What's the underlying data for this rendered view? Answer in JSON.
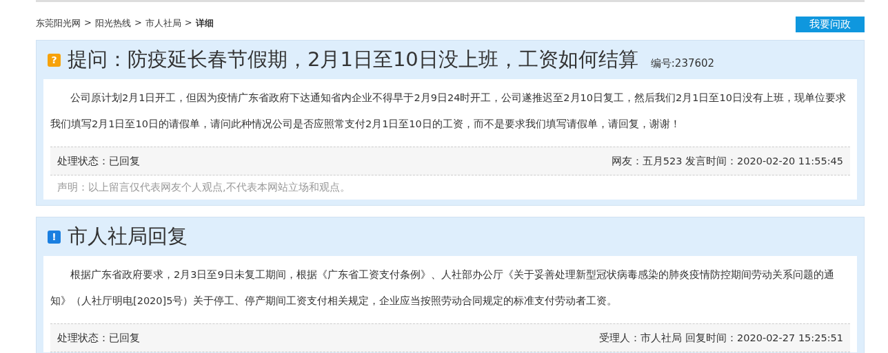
{
  "breadcrumb": {
    "separator": ">",
    "items": [
      {
        "label": "东莞阳光网",
        "current": false
      },
      {
        "label": "阳光热线",
        "current": false
      },
      {
        "label": "市人社局",
        "current": false
      },
      {
        "label": "详细",
        "current": true
      }
    ]
  },
  "ask_button": "我要问政",
  "sections": [
    {
      "kind": "question",
      "icon": "?",
      "title": "提问：防疫延长春节假期，2月1日至10日没上班，工资如何结算",
      "number": "编号:237602",
      "body": "公司原计划2月1日开工，但因为疫情广东省政府下达通知省内企业不得早于2月9日24时开工，公司遂推迟至2月10日复工，然后我们2月1日至10日没有上班，现单位要求我们填写2月1日至10日的请假单，请问此种情况公司是否应照常支付2月1日至10日的工资，而不是要求我们填写请假单，请回复，谢谢！",
      "status": "处理状态：已回复",
      "meta": "网友：五月523 发言时间：2020-02-20 11:55:45",
      "disclaimer": "声明：以上留言仅代表网友个人观点,不代表本网站立场和观点。"
    },
    {
      "kind": "reply",
      "icon": "!",
      "title": "市人社局回复",
      "body": "根据广东省政府要求，2月3日至9日未复工期间，根据《广东省工资支付条例》、人社部办公厅《关于妥善处理新型冠状病毒感染的肺炎疫情防控期间劳动关系问题的通知》（人社厅明电[2020]5号）关于停工、停产期间工资支付相关规定，企业应当按照劳动合同规定的标准支付劳动者工资。",
      "status": "处理状态：已回复",
      "meta": "受理人：市人社局 回复时间：2020-02-27 15:25:51"
    }
  ]
}
